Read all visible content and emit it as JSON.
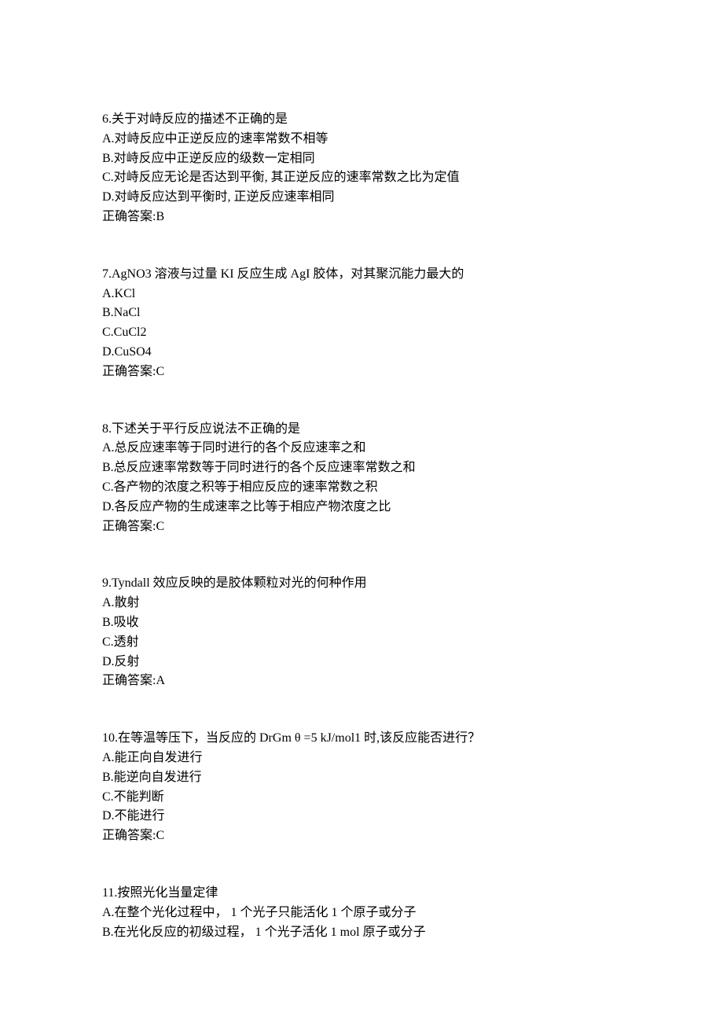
{
  "questions": [
    {
      "stem": "6.关于对峙反应的描述不正确的是",
      "options": [
        "A.对峙反应中正逆反应的速率常数不相等",
        "B.对峙反应中正逆反应的级数一定相同",
        "C.对峙反应无论是否达到平衡, 其正逆反应的速率常数之比为定值",
        "D.对峙反应达到平衡时, 正逆反应速率相同"
      ],
      "answer": "正确答案:B"
    },
    {
      "stem": "7.AgNO3 溶液与过量 KI 反应生成 AgI 胶体，对其聚沉能力最大的",
      "options": [
        "A.KCl",
        "B.NaCl",
        "C.CuCl2",
        "D.CuSO4"
      ],
      "answer": "正确答案:C"
    },
    {
      "stem": "8.下述关于平行反应说法不正确的是",
      "options": [
        "A.总反应速率等于同时进行的各个反应速率之和",
        "B.总反应速率常数等于同时进行的各个反应速率常数之和",
        "C.各产物的浓度之积等于相应反应的速率常数之积",
        "D.各反应产物的生成速率之比等于相应产物浓度之比"
      ],
      "answer": "正确答案:C"
    },
    {
      "stem": "9.Tyndall 效应反映的是胶体颗粒对光的何种作用",
      "options": [
        "A.散射",
        "B.吸收",
        "C.透射",
        "D.反射"
      ],
      "answer": "正确答案:A"
    },
    {
      "stem": "10.在等温等压下，当反应的 DrGm θ =5 kJ/mol1 时,该反应能否进行？",
      "options": [
        "A.能正向自发进行",
        "B.能逆向自发进行",
        "C.不能判断",
        "D.不能进行"
      ],
      "answer": "正确答案:C"
    },
    {
      "stem": "11.按照光化当量定律",
      "options": [
        "A.在整个光化过程中， 1 个光子只能活化 1 个原子或分子",
        "B.在光化反应的初级过程， 1 个光子活化 1 mol 原子或分子"
      ],
      "answer": ""
    }
  ]
}
